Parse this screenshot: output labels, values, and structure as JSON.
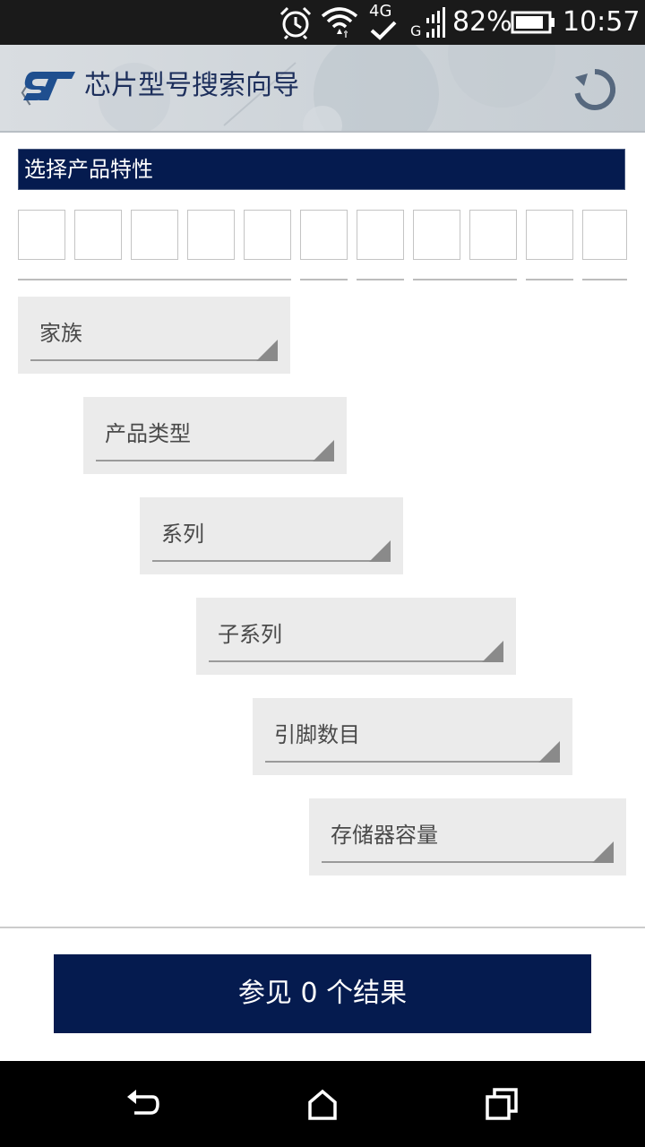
{
  "status_bar": {
    "battery": "82%",
    "time": "10:57",
    "network_4g": "4G",
    "network_g": "G"
  },
  "app_bar": {
    "title": "芯片型号搜索向导",
    "logo": "ST"
  },
  "section": {
    "header": "选择产品特性"
  },
  "filters": [
    {
      "label": "家族"
    },
    {
      "label": "产品类型"
    },
    {
      "label": "系列"
    },
    {
      "label": "子系列"
    },
    {
      "label": "引脚数目"
    },
    {
      "label": "存储器容量"
    }
  ],
  "results_button": {
    "label": "参见 0 个结果"
  },
  "colors": {
    "primary": "#051b4f",
    "dropdown_bg": "#ebebeb",
    "title_text": "#1d2f5c"
  }
}
